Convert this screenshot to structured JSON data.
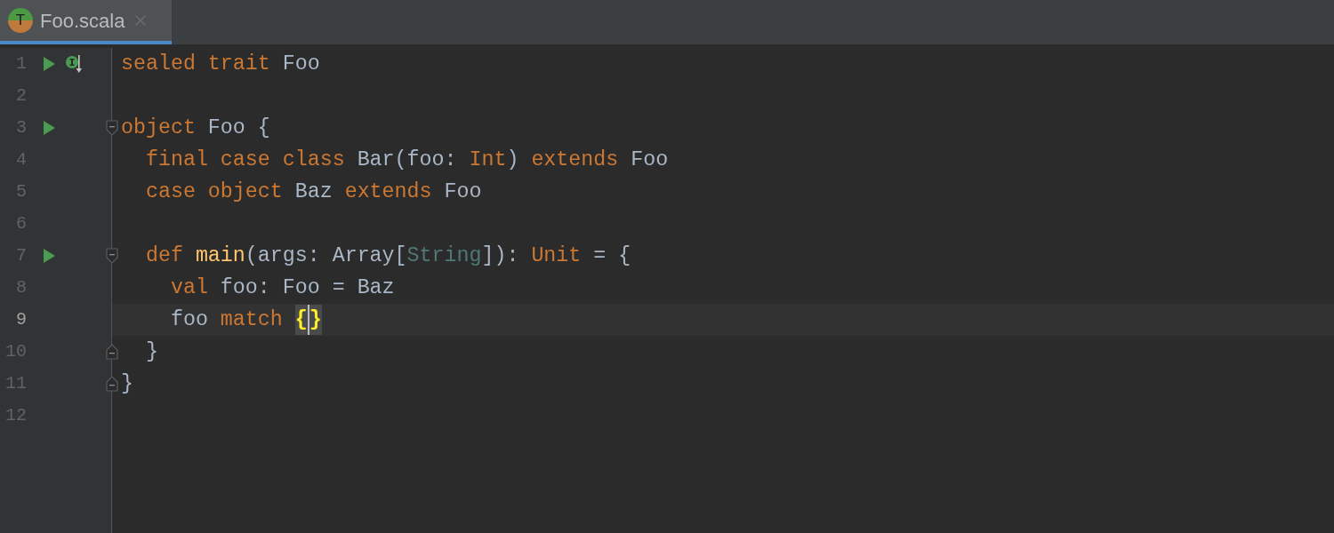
{
  "tabs": [
    {
      "label": "Foo.scala",
      "icon_letter": "T",
      "selected": true
    }
  ],
  "lines": [
    {
      "number": "1",
      "current": false,
      "run_marker": true,
      "implemented_marker": true,
      "fold_start": false,
      "fold_end": false,
      "tokens": [
        {
          "text": "sealed trait",
          "kind": "keyword"
        },
        {
          "text": " Foo",
          "kind": "plain"
        }
      ]
    },
    {
      "number": "2",
      "current": false,
      "run_marker": false,
      "implemented_marker": false,
      "fold_start": false,
      "fold_end": false
    },
    {
      "number": "3",
      "current": false,
      "run_marker": true,
      "implemented_marker": false,
      "fold_start": true,
      "fold_end": false,
      "tokens": [
        {
          "text": "object",
          "kind": "keyword"
        },
        {
          "text": " Foo {",
          "kind": "plain"
        }
      ]
    },
    {
      "number": "4",
      "current": false,
      "run_marker": false,
      "implemented_marker": false,
      "fold_start": false,
      "fold_end": false,
      "tokens": [
        {
          "text": "  final case class",
          "kind": "keyword"
        },
        {
          "text": " Bar(foo: ",
          "kind": "plain"
        },
        {
          "text": "Int",
          "kind": "keyword"
        },
        {
          "text": ") ",
          "kind": "plain"
        },
        {
          "text": "extends",
          "kind": "keyword"
        },
        {
          "text": " Foo",
          "kind": "plain"
        }
      ]
    },
    {
      "number": "5",
      "current": false,
      "run_marker": false,
      "implemented_marker": false,
      "fold_start": false,
      "fold_end": false,
      "tokens": [
        {
          "text": "  case object",
          "kind": "keyword"
        },
        {
          "text": " Baz ",
          "kind": "plain"
        },
        {
          "text": "extends",
          "kind": "keyword"
        },
        {
          "text": " Foo",
          "kind": "plain"
        }
      ]
    },
    {
      "number": "6",
      "current": false,
      "run_marker": false,
      "implemented_marker": false,
      "fold_start": false,
      "fold_end": false
    },
    {
      "number": "7",
      "current": false,
      "run_marker": true,
      "implemented_marker": false,
      "fold_start": true,
      "fold_end": false,
      "tokens": [
        {
          "text": "  def",
          "kind": "keyword"
        },
        {
          "text": " main",
          "kind": "function"
        },
        {
          "text": "(args: Array[",
          "kind": "plain"
        },
        {
          "text": "String",
          "kind": "type_param"
        },
        {
          "text": "]): ",
          "kind": "plain"
        },
        {
          "text": "Unit",
          "kind": "keyword"
        },
        {
          "text": " = {",
          "kind": "plain"
        }
      ]
    },
    {
      "number": "8",
      "current": false,
      "run_marker": false,
      "implemented_marker": false,
      "fold_start": false,
      "fold_end": false,
      "tokens": [
        {
          "text": "    val",
          "kind": "keyword"
        },
        {
          "text": " foo: Foo = Baz",
          "kind": "plain"
        }
      ]
    },
    {
      "number": "9",
      "current": true,
      "run_marker": false,
      "implemented_marker": false,
      "fold_start": false,
      "fold_end": false,
      "tokens": [
        {
          "text": "    foo ",
          "kind": "plain"
        },
        {
          "text": "match ",
          "kind": "keyword"
        },
        {
          "text": "{",
          "kind": "brace_match",
          "caret_before": false
        },
        {
          "text": "}",
          "kind": "brace_match",
          "caret_before": true
        }
      ]
    },
    {
      "number": "10",
      "current": false,
      "run_marker": false,
      "implemented_marker": false,
      "fold_start": false,
      "fold_end": true,
      "tokens": [
        {
          "text": "  }",
          "kind": "plain"
        }
      ]
    },
    {
      "number": "11",
      "current": false,
      "run_marker": false,
      "implemented_marker": false,
      "fold_start": false,
      "fold_end": true,
      "tokens": [
        {
          "text": "}",
          "kind": "plain"
        }
      ]
    },
    {
      "number": "12",
      "current": false,
      "run_marker": false,
      "implemented_marker": false,
      "fold_start": false,
      "fold_end": false
    }
  ]
}
